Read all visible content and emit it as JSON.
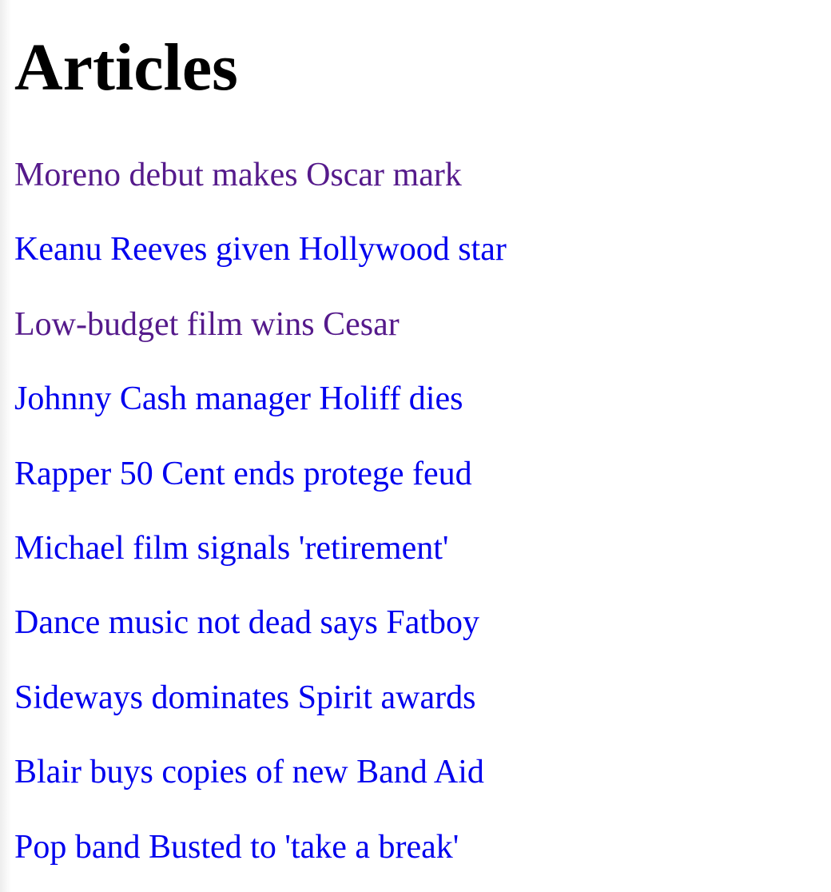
{
  "page": {
    "title": "Articles"
  },
  "colors": {
    "link": "#0000ee",
    "visited": "#551a8b",
    "heading": "#000000",
    "background": "#ffffff"
  },
  "articles": [
    {
      "label": "Moreno debut makes Oscar mark",
      "visited": true
    },
    {
      "label": "Keanu Reeves given Hollywood star",
      "visited": false
    },
    {
      "label": "Low-budget film wins Cesar",
      "visited": true
    },
    {
      "label": "Johnny Cash manager Holiff dies",
      "visited": false
    },
    {
      "label": "Rapper 50 Cent ends protege feud",
      "visited": false
    },
    {
      "label": "Michael film signals 'retirement'",
      "visited": false
    },
    {
      "label": "Dance music not dead says Fatboy",
      "visited": false
    },
    {
      "label": "Sideways dominates Spirit awards",
      "visited": false
    },
    {
      "label": "Blair buys copies of new Band Aid",
      "visited": false
    },
    {
      "label": "Pop band Busted to 'take a break'",
      "visited": false
    }
  ]
}
